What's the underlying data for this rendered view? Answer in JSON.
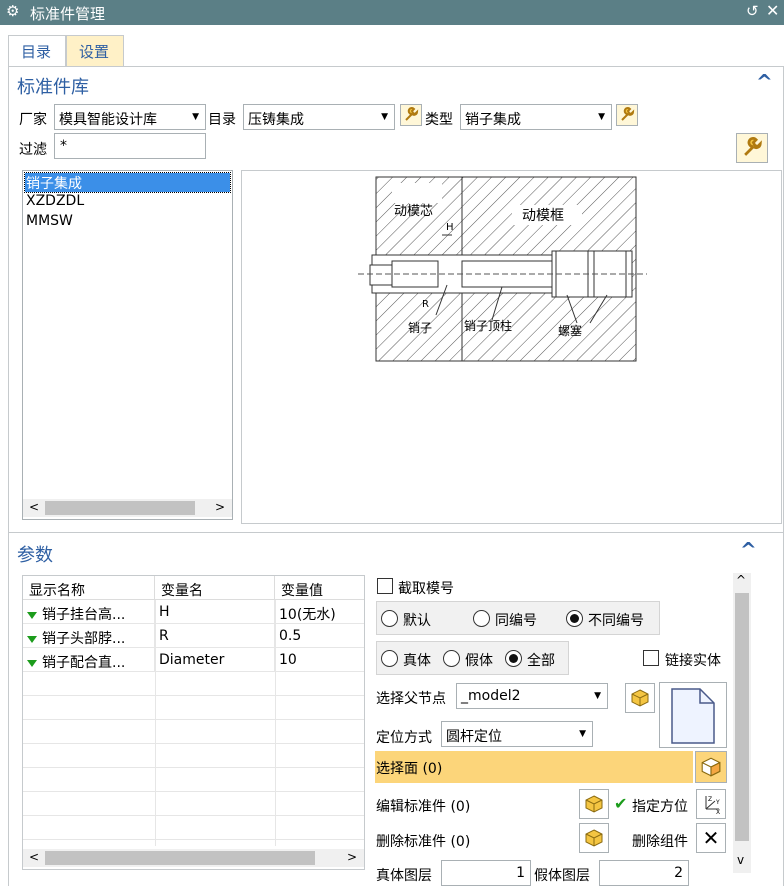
{
  "window": {
    "title": "标准件管理"
  },
  "tabs": [
    {
      "label": "目录"
    },
    {
      "label": "设置"
    }
  ],
  "library": {
    "section_title": "标准件库",
    "vendor_label": "厂家",
    "vendor_value": "模具智能设计库",
    "catalog_label": "目录",
    "catalog_value": "压铸集成",
    "type_label": "类型",
    "type_value": "销子集成",
    "filter_label": "过滤",
    "filter_value": "*",
    "items": [
      "销子集成",
      "XZDZDL",
      "MMSW"
    ]
  },
  "diagram": {
    "labels": {
      "core": "动模芯",
      "frame": "动模框",
      "h": "H",
      "r": "R",
      "pin": "销子",
      "pin_post": "销子顶柱",
      "screw": "螺塞"
    }
  },
  "params": {
    "section_title": "参数",
    "columns": [
      "显示名称",
      "变量名",
      "变量值"
    ],
    "rows": [
      {
        "name": "销子挂台高...",
        "var": "H",
        "value": "10(无水)"
      },
      {
        "name": "销子头部脖...",
        "var": "R",
        "value": "0.5"
      },
      {
        "name": "销子配合直...",
        "var": "Diameter",
        "value": "10"
      }
    ],
    "capture_label": "截取模号",
    "numbering": [
      "默认",
      "同编号",
      "不同编号"
    ],
    "body_types": [
      "真体",
      "假体",
      "全部"
    ],
    "link_label": "链接实体",
    "parent_label": "选择父节点",
    "parent_value": "_model2",
    "position_label": "定位方式",
    "position_value": "圆杆定位",
    "select_face": "选择面 (0)",
    "edit_std": "编辑标准件 (0)",
    "delete_std": "删除标准件 (0)",
    "orient_label": "指定方位",
    "delete_comp": "删除组件",
    "true_layer_label": "真体图层",
    "true_layer_value": "1",
    "fake_layer_label": "假体图层",
    "fake_layer_value": "2"
  },
  "colors": {
    "title_bar": "#5b7f86",
    "accent": "#2e5fa3",
    "highlight": "#fcd57a",
    "selection": "#3b8fe8"
  }
}
